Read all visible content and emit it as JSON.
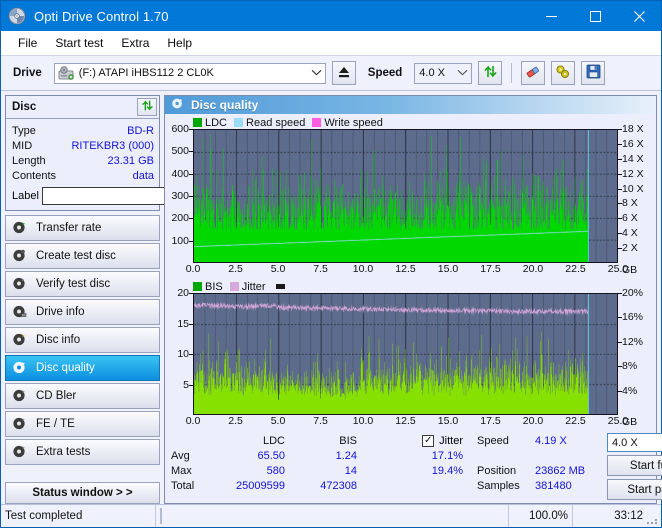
{
  "window": {
    "title": "Opti Drive Control 1.70",
    "app_icon": "disc-icon",
    "minimize": "—",
    "maximize": "☐",
    "close": "✕"
  },
  "menu": {
    "items": [
      {
        "label": "File"
      },
      {
        "label": "Start test"
      },
      {
        "label": "Extra"
      },
      {
        "label": "Help"
      }
    ]
  },
  "toolbar": {
    "drive_label": "Drive",
    "drive_value": "(F:)  ATAPI iHBS112  2 CL0K",
    "drive_icon": "drive-icon",
    "eject_icon": "eject-icon",
    "speed_label": "Speed",
    "speed_value": "4.0 X",
    "refresh_icon": "refresh-icon",
    "erase_icon": "eraser-icon",
    "tools_icon": "tools-icon",
    "save_icon": "save-icon"
  },
  "disc_panel": {
    "title": "Disc",
    "refresh_icon": "refresh-icon",
    "rows": [
      {
        "key": "Type",
        "value": "BD-R"
      },
      {
        "key": "MID",
        "value": "RITEKBR3 (000)"
      },
      {
        "key": "Length",
        "value": "23.31 GB"
      },
      {
        "key": "Contents",
        "value": "data"
      }
    ],
    "label_key": "Label",
    "label_value": "",
    "label_placeholder": "",
    "disc_icon": "cd-disc-icon"
  },
  "nav": {
    "items": [
      {
        "label": "Transfer rate",
        "icon": "disc-test-icon",
        "active": false
      },
      {
        "label": "Create test disc",
        "icon": "disc-burn-icon",
        "active": false
      },
      {
        "label": "Verify test disc",
        "icon": "disc-verify-icon",
        "active": false
      },
      {
        "label": "Drive info",
        "icon": "disc-drive-icon",
        "active": false
      },
      {
        "label": "Disc info",
        "icon": "disc-info-icon",
        "active": false
      },
      {
        "label": "Disc quality",
        "icon": "disc-quality-icon",
        "active": true
      },
      {
        "label": "CD Bler",
        "icon": "disc-bler-icon",
        "active": false
      },
      {
        "label": "FE / TE",
        "icon": "disc-fete-icon",
        "active": false
      },
      {
        "label": "Extra tests",
        "icon": "disc-extra-icon",
        "active": false
      }
    ],
    "status_window": "Status window > >"
  },
  "panel": {
    "title": "Disc quality",
    "icon": "disc-quality-icon"
  },
  "chart_data": [
    {
      "type": "bar",
      "name": "ldc-chart",
      "title": "",
      "legend": [
        {
          "label": "LDC",
          "color": "#00a800"
        },
        {
          "label": "Read speed",
          "color": "#9adcf5"
        },
        {
          "label": "Write speed",
          "color": "#ff5ce0"
        }
      ],
      "legend_position": "top-left",
      "grid": true,
      "xlabel": "GB",
      "xlim": [
        0,
        25
      ],
      "xticks": [
        0.0,
        2.5,
        5.0,
        7.5,
        10.0,
        12.5,
        15.0,
        17.5,
        20.0,
        22.5,
        25.0
      ],
      "xticklabels": [
        "0.0",
        "2.5",
        "5.0",
        "7.5",
        "10.0",
        "12.5",
        "15.0",
        "17.5",
        "20.0",
        "22.5",
        "25.0"
      ],
      "ylabel": "",
      "ylim": [
        0,
        600
      ],
      "yticks": [
        100,
        200,
        300,
        400,
        500,
        600
      ],
      "yticklabels": [
        "100",
        "200",
        "300",
        "400",
        "500",
        "600"
      ],
      "y2label": "",
      "y2lim": [
        0,
        18
      ],
      "y2ticks": [
        2,
        4,
        6,
        8,
        10,
        12,
        14,
        16,
        18
      ],
      "y2ticklabels": [
        "2 X",
        "4 X",
        "6 X",
        "8 X",
        "10 X",
        "12 X",
        "14 X",
        "16 X",
        "18 X"
      ],
      "data_end_x": 23.31,
      "series": [
        {
          "name": "LDC",
          "color": "#00d800",
          "kind": "bars",
          "baseline_avg": 65.5,
          "band_low": 150,
          "band_high": 330,
          "peak_max": 580
        },
        {
          "name": "Read speed",
          "color": "#9adcf5",
          "kind": "line",
          "start_y": 2.1,
          "end_y": 4.19
        }
      ]
    },
    {
      "type": "bar",
      "name": "bis-jitter-chart",
      "title": "",
      "legend": [
        {
          "label": "BIS",
          "color": "#00a800"
        },
        {
          "label": "Jitter",
          "color": "#d9a8dd"
        }
      ],
      "legend_position": "top-left",
      "grid": true,
      "xlabel": "GB",
      "xlim": [
        0,
        25
      ],
      "xticks": [
        0.0,
        2.5,
        5.0,
        7.5,
        10.0,
        12.5,
        15.0,
        17.5,
        20.0,
        22.5,
        25.0
      ],
      "xticklabels": [
        "0.0",
        "2.5",
        "5.0",
        "7.5",
        "10.0",
        "12.5",
        "15.0",
        "17.5",
        "20.0",
        "22.5",
        "25.0"
      ],
      "ylim": [
        0,
        20
      ],
      "yticks": [
        5,
        10,
        15,
        20
      ],
      "yticklabels": [
        "5",
        "10",
        "15",
        "20"
      ],
      "y2lim": [
        0,
        20
      ],
      "y2ticks": [
        4,
        8,
        12,
        16,
        20
      ],
      "y2ticklabels": [
        "4%",
        "8%",
        "12%",
        "16%",
        "20%"
      ],
      "data_end_x": 23.31,
      "series": [
        {
          "name": "BIS",
          "color": "#86e000",
          "kind": "bars",
          "baseline_avg": 1.24,
          "band_low": 3.5,
          "band_high": 8.5,
          "peak_max": 14
        },
        {
          "name": "Jitter",
          "color": "#d9a8dd",
          "kind": "line",
          "start_y": 18.0,
          "end_y": 17.1
        }
      ]
    }
  ],
  "stats": {
    "col_headers": [
      "LDC",
      "BIS"
    ],
    "rows": [
      {
        "label": "Avg",
        "ldc": "65.50",
        "bis": "1.24",
        "jitter": "17.1%"
      },
      {
        "label": "Max",
        "ldc": "580",
        "bis": "14",
        "jitter": "19.4%"
      },
      {
        "label": "Total",
        "ldc": "25009599",
        "bis": "472308",
        "jitter": ""
      }
    ],
    "jitter_label": "Jitter",
    "jitter_checked": true,
    "jitter_check_glyph": "✓",
    "speed_label": "Speed",
    "speed_value": "4.19 X",
    "position_label": "Position",
    "position_value": "23862 MB",
    "samples_label": "Samples",
    "samples_value": "381480",
    "speed_select": "4.0 X",
    "start_full": "Start full",
    "start_part": "Start part"
  },
  "statusbar": {
    "message": "Test completed",
    "progress_percent": 100.0,
    "progress_text": "100.0%",
    "elapsed": "33:12"
  },
  "colors": {
    "accent": "#0078d7",
    "plot_bg": "#5d6b8c",
    "ldc_green": "#00d800",
    "bis_green": "#86e000",
    "read_speed": "#9adcf5",
    "write_speed": "#ff5ce0",
    "jitter": "#d9a8dd",
    "value_text": "#1414d4",
    "progress": "#0cb10c"
  }
}
